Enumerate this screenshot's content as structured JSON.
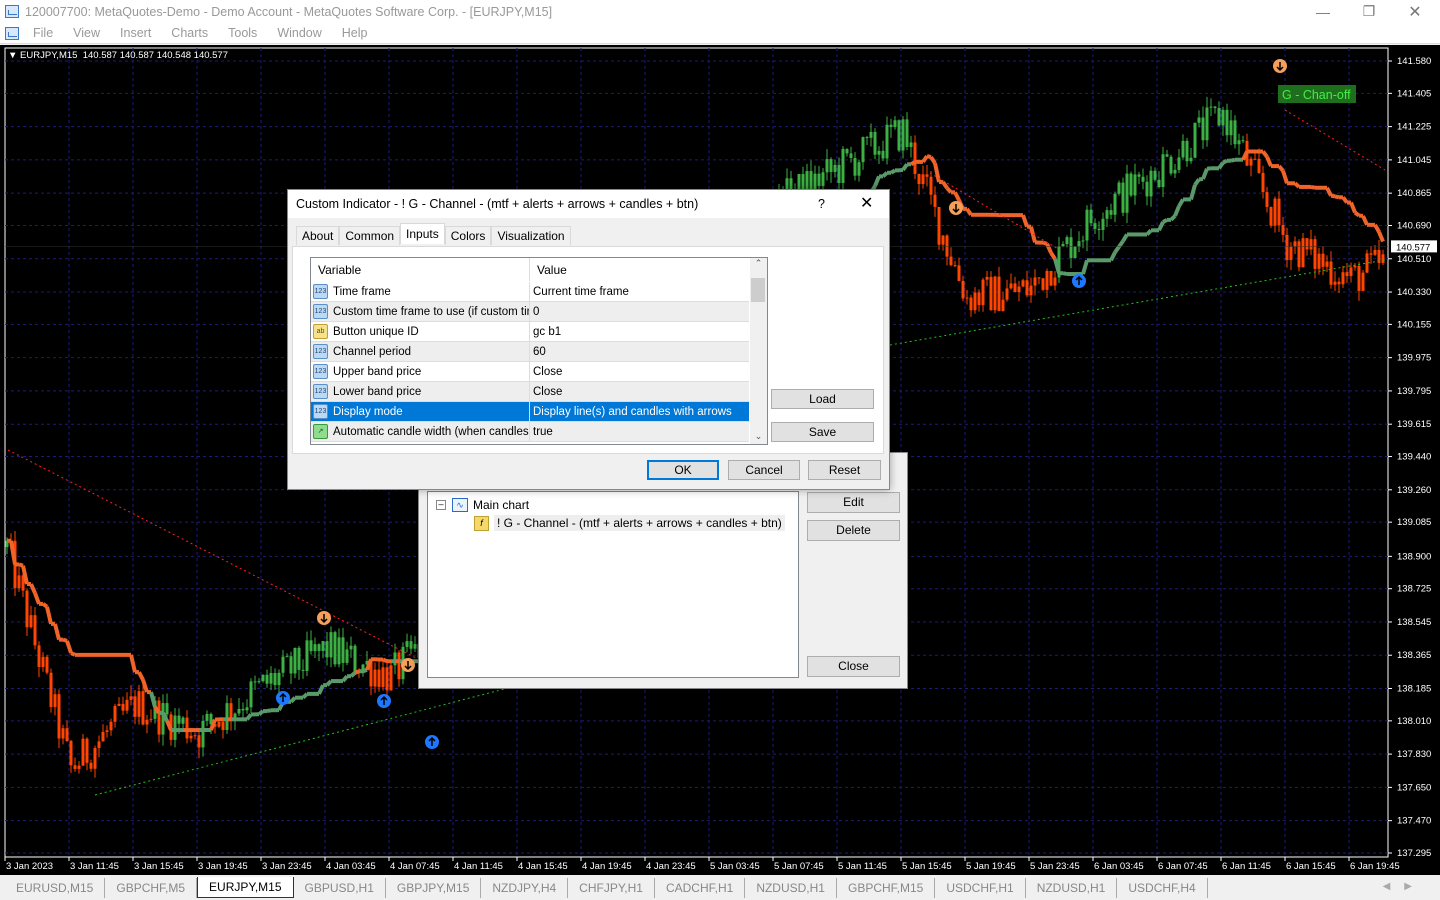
{
  "window": {
    "title": "120007700: MetaQuotes-Demo - Demo Account - MetaQuotes Software Corp. - [EURJPY,M15]"
  },
  "menu": [
    "File",
    "View",
    "Insert",
    "Charts",
    "Tools",
    "Window",
    "Help"
  ],
  "chart_header": {
    "symbol": "EURJPY,M15",
    "ohlc": "140.587 140.587 140.548 140.577"
  },
  "chart_data": {
    "type": "candlestick",
    "price_ticks": [
      "141.580",
      "141.405",
      "141.225",
      "141.045",
      "140.865",
      "140.690",
      "140.510",
      "140.330",
      "140.155",
      "139.975",
      "139.795",
      "139.615",
      "139.440",
      "139.260",
      "139.085",
      "138.900",
      "138.725",
      "138.545",
      "138.365",
      "138.185",
      "138.010",
      "137.830",
      "137.650",
      "137.470",
      "137.295"
    ],
    "ylim": [
      137.295,
      141.58
    ],
    "time_ticks": [
      "3 Jan 2023",
      "3 Jan 11:45",
      "3 Jan 15:45",
      "3 Jan 19:45",
      "3 Jan 23:45",
      "4 Jan 03:45",
      "4 Jan 07:45",
      "4 Jan 11:45",
      "4 Jan 15:45",
      "4 Jan 19:45",
      "4 Jan 23:45",
      "5 Jan 03:45",
      "5 Jan 07:45",
      "5 Jan 11:45",
      "5 Jan 15:45",
      "5 Jan 19:45",
      "5 Jan 23:45",
      "6 Jan 03:45",
      "6 Jan 07:45",
      "6 Jan 11:45",
      "6 Jan 15:45",
      "6 Jan 19:45"
    ],
    "approx_price_at_ticks": [
      138.95,
      137.75,
      138.1,
      137.95,
      138.2,
      138.4,
      138.25,
      138.6,
      139.0,
      139.4,
      139.8,
      140.3,
      140.8,
      141.0,
      141.2,
      140.3,
      140.35,
      140.75,
      141.0,
      141.3,
      140.6,
      140.4
    ],
    "last_price": "140.577",
    "colors": {
      "bull": "#3cb043",
      "bear": "#ff4500",
      "grid": "#1c1c7a",
      "upper_dots": "#ff2020",
      "lower_dots": "#22c022",
      "arrow_down": "#f5a05a",
      "arrow_up": "#1e78ff"
    },
    "button_label": "G - Chan-off"
  },
  "indicator_dialog": {
    "title": "Custom Indicator - ! G - Channel - (mtf + alerts + arrows + candles + btn)",
    "help": "?",
    "tabs": [
      "About",
      "Common",
      "Inputs",
      "Colors",
      "Visualization"
    ],
    "active_tab": "Inputs",
    "columns": [
      "Variable",
      "Value"
    ],
    "rows": [
      {
        "type": "123",
        "variable": "Time frame",
        "value": "Current time frame"
      },
      {
        "type": "123",
        "variable": "Custom time frame to use (if custom tim...",
        "value": "0"
      },
      {
        "type": "ab",
        "variable": "Button unique ID",
        "value": "gc b1"
      },
      {
        "type": "123",
        "variable": "Channel period",
        "value": "60"
      },
      {
        "type": "123",
        "variable": "Upper band price",
        "value": "Close"
      },
      {
        "type": "123",
        "variable": "Lower band price",
        "value": "Close"
      },
      {
        "type": "123",
        "variable": "Display mode",
        "value": "Display line(s) and candles with arrows",
        "selected": true
      },
      {
        "type": "bool",
        "variable": "Automatic candle width (when candles...",
        "value": "true"
      }
    ],
    "load": "Load",
    "save": "Save",
    "ok": "OK",
    "cancel": "Cancel",
    "reset": "Reset"
  },
  "indicators_list": {
    "root": "Main chart",
    "items": [
      "! G - Channel - (mtf + alerts + arrows + candles + btn)"
    ],
    "edit": "Edit",
    "delete": "Delete",
    "close": "Close"
  },
  "chart_tabs": [
    "EURUSD,M15",
    "GBPCHF,M5",
    "EURJPY,M15",
    "GBPUSD,H1",
    "GBPJPY,M15",
    "NZDJPY,H4",
    "CHFJPY,H1",
    "CADCHF,H1",
    "NZDUSD,H1",
    "GBPCHF,M15",
    "USDCHF,H1",
    "NZDUSD,H1",
    "USDCHF,H4"
  ],
  "active_chart_tab": "EURJPY,M15"
}
